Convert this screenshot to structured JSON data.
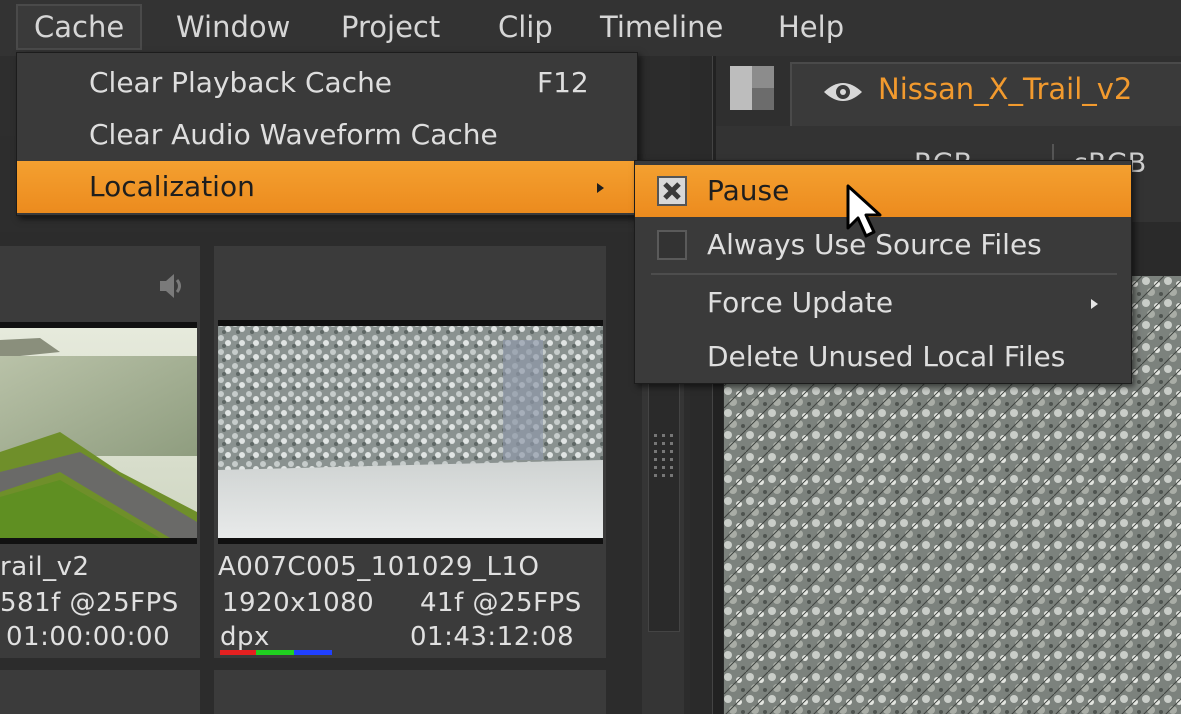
{
  "menubar": {
    "items": [
      "Cache",
      "Window",
      "Project",
      "Clip",
      "Timeline",
      "Help"
    ],
    "open_item": "Cache"
  },
  "cache_menu": {
    "items": [
      {
        "label": "Clear Playback Cache",
        "shortcut": "F12"
      },
      {
        "label": "Clear Audio Waveform Cache",
        "shortcut": ""
      },
      {
        "label": "Localization",
        "shortcut": "",
        "submenu": true,
        "highlighted": true
      }
    ]
  },
  "localization_menu": {
    "items": [
      {
        "label": "Pause",
        "checked": true,
        "highlighted": true
      },
      {
        "label": "Always Use Source Files",
        "checked": false
      },
      {
        "label": "Force Update",
        "submenu": true
      },
      {
        "label": "Delete Unused Local Files"
      }
    ]
  },
  "viewer": {
    "tab_label": "Nissan_X_Trail_v2",
    "toolbar_items": [
      "RGB",
      "sRGB"
    ]
  },
  "bin": {
    "clips": [
      {
        "name": "rail_v2",
        "frames": "581f @25FPS",
        "resolution": "",
        "timecode": "01:00:00:00",
        "format": ""
      },
      {
        "name": "A007C005_101029_L1O",
        "resolution": "1920x1080",
        "frames": "41f @25FPS",
        "format": "dpx",
        "timecode": "01:43:12:08"
      }
    ]
  },
  "colors": {
    "accent": "#f09325",
    "tab_text": "#f29a2e",
    "menu_bg": "#3a3a3a"
  }
}
